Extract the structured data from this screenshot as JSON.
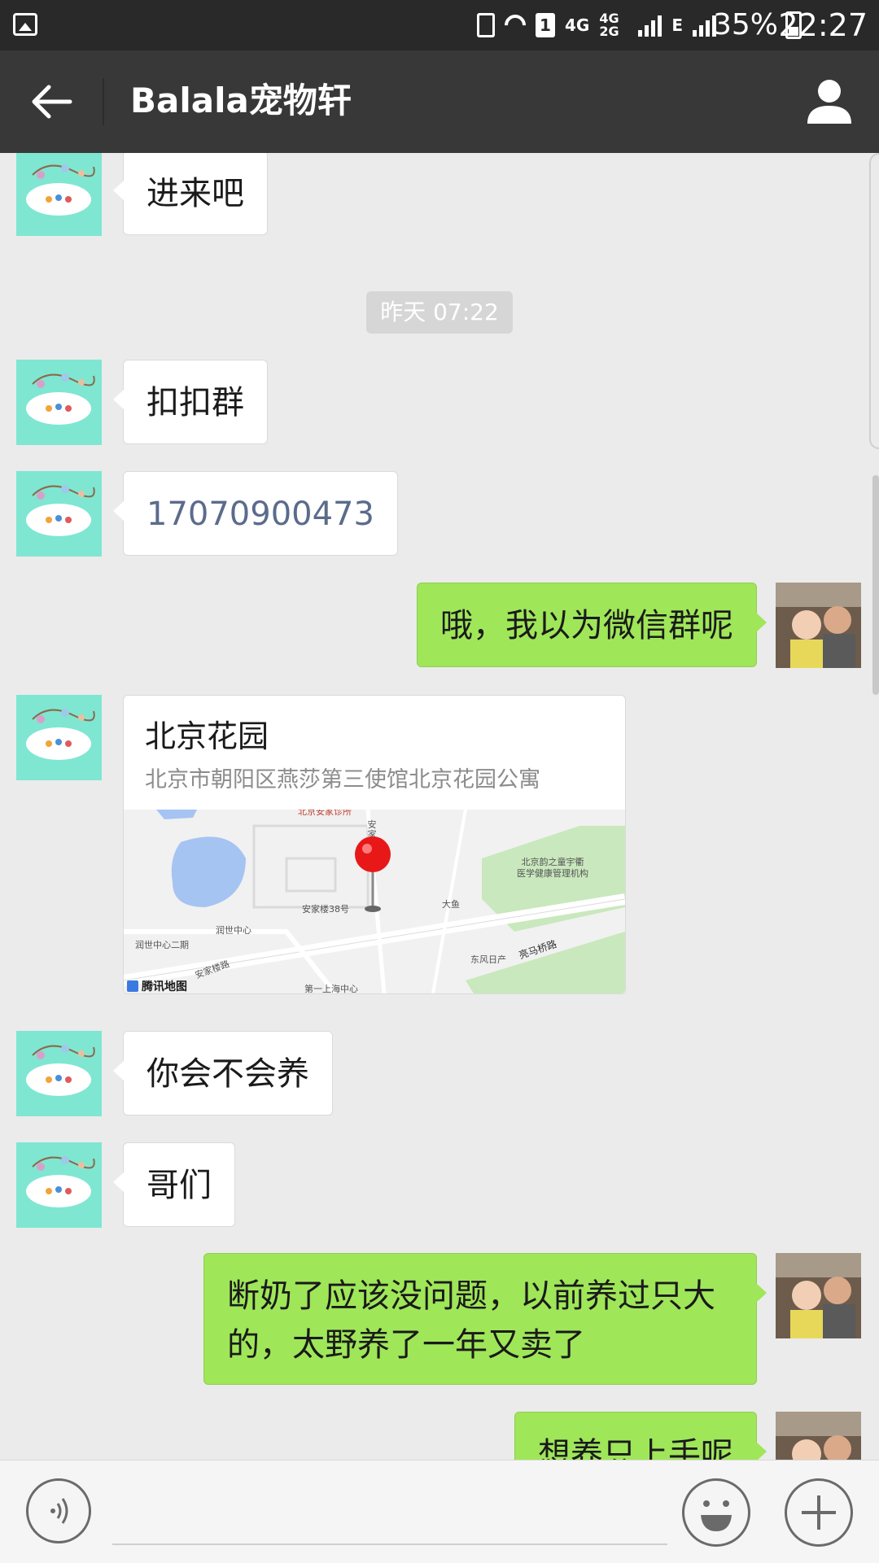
{
  "status_bar": {
    "sim_slot": "1",
    "net_4g": "4G",
    "net_4g2g": "4G 2G",
    "net_e": "E",
    "battery": "35%",
    "time": "22:27"
  },
  "header": {
    "title": "Balala宠物轩",
    "back_icon": "arrow-left-icon",
    "profile_icon": "person-icon"
  },
  "messages": [
    {
      "from": "other",
      "type": "text",
      "text": "进来吧"
    },
    {
      "type": "timestamp",
      "text": "昨天 07:22"
    },
    {
      "from": "other",
      "type": "text",
      "text": "扣扣群"
    },
    {
      "from": "other",
      "type": "phone",
      "text": "17070900473"
    },
    {
      "from": "me",
      "type": "text",
      "text": "哦，我以为微信群呢"
    },
    {
      "from": "other",
      "type": "location",
      "title": "北京花园",
      "address": "北京市朝阳区燕莎第三使馆北京花园公寓"
    },
    {
      "from": "other",
      "type": "text",
      "text": "你会不会养"
    },
    {
      "from": "other",
      "type": "text",
      "text": "哥们"
    },
    {
      "from": "me",
      "type": "text",
      "text": "断奶了应该没问题，以前养过只大的，太野养了一年又卖了"
    },
    {
      "from": "me",
      "type": "text",
      "text": "想养只上手呢"
    }
  ],
  "map_labels": {
    "top_clinic": "北京安家诊所",
    "an": "安",
    "jia": "家",
    "health": "北京韵之童宇衢",
    "health2": "医学健康管理机构",
    "anjialou": "安家楼38号",
    "dayu": "大鱼",
    "runshi": "润世中心",
    "runshi2": "润世中心二期",
    "anjialu": "安家楼路",
    "dongfeng": "东风日产",
    "liangma": "亮马桥路",
    "haizhongxin": "第一上海中心",
    "tencent": "腾讯地图"
  },
  "input_bar": {
    "voice_icon": "voice-icon",
    "emoji_icon": "smiley-icon",
    "plus_icon": "plus-icon",
    "text_value": ""
  }
}
